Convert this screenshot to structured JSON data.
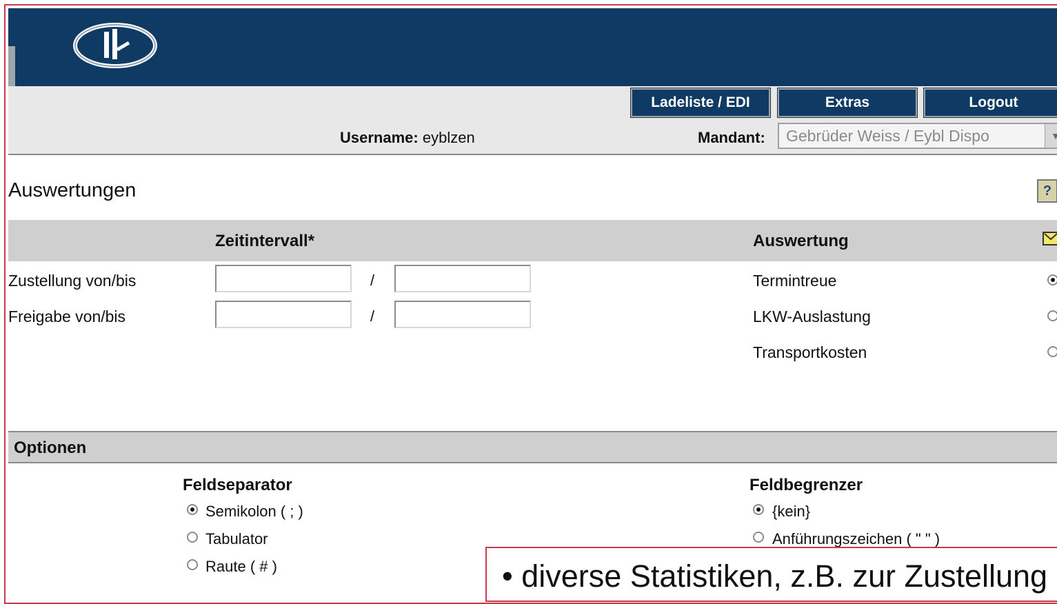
{
  "nav": {
    "ladeliste": "Ladeliste / EDI",
    "extras": "Extras",
    "logout": "Logout"
  },
  "user": {
    "username_label": "Username:",
    "username_value": "eyblzen",
    "mandant_label": "Mandant:",
    "mandant_value": "Gebrüder Weiss / Eybl Dispo"
  },
  "page": {
    "title": "Auswertungen"
  },
  "zeitintervall": {
    "heading": "Zeitintervall*",
    "rows": [
      {
        "label": "Zustellung von/bis",
        "from": "",
        "to": "",
        "separator": "/"
      },
      {
        "label": "Freigabe von/bis",
        "from": "",
        "to": "",
        "separator": "/"
      }
    ]
  },
  "auswertung": {
    "heading": "Auswertung",
    "options": [
      {
        "label": "Termintreue",
        "selected": true
      },
      {
        "label": "LKW-Auslastung",
        "selected": false
      },
      {
        "label": "Transportkosten",
        "selected": false
      }
    ]
  },
  "optionen": {
    "heading": "Optionen",
    "feldseparator": {
      "heading": "Feldseparator",
      "options": [
        {
          "label": "Semikolon ( ; )",
          "selected": true
        },
        {
          "label": "Tabulator",
          "selected": false
        },
        {
          "label": "Raute ( # )",
          "selected": false
        }
      ]
    },
    "feldbegrenzer": {
      "heading": "Feldbegrenzer",
      "options": [
        {
          "label": "{kein}",
          "selected": true
        },
        {
          "label": "Anführungszeichen ( \" \" )",
          "selected": false
        }
      ]
    }
  },
  "callout": {
    "text": "• diverse Statistiken, z.B. zur Zustellung"
  },
  "colors": {
    "header_bg": "#0f3a63",
    "section_bg": "#cfcfcf",
    "callout_border": "#c83a4a"
  }
}
